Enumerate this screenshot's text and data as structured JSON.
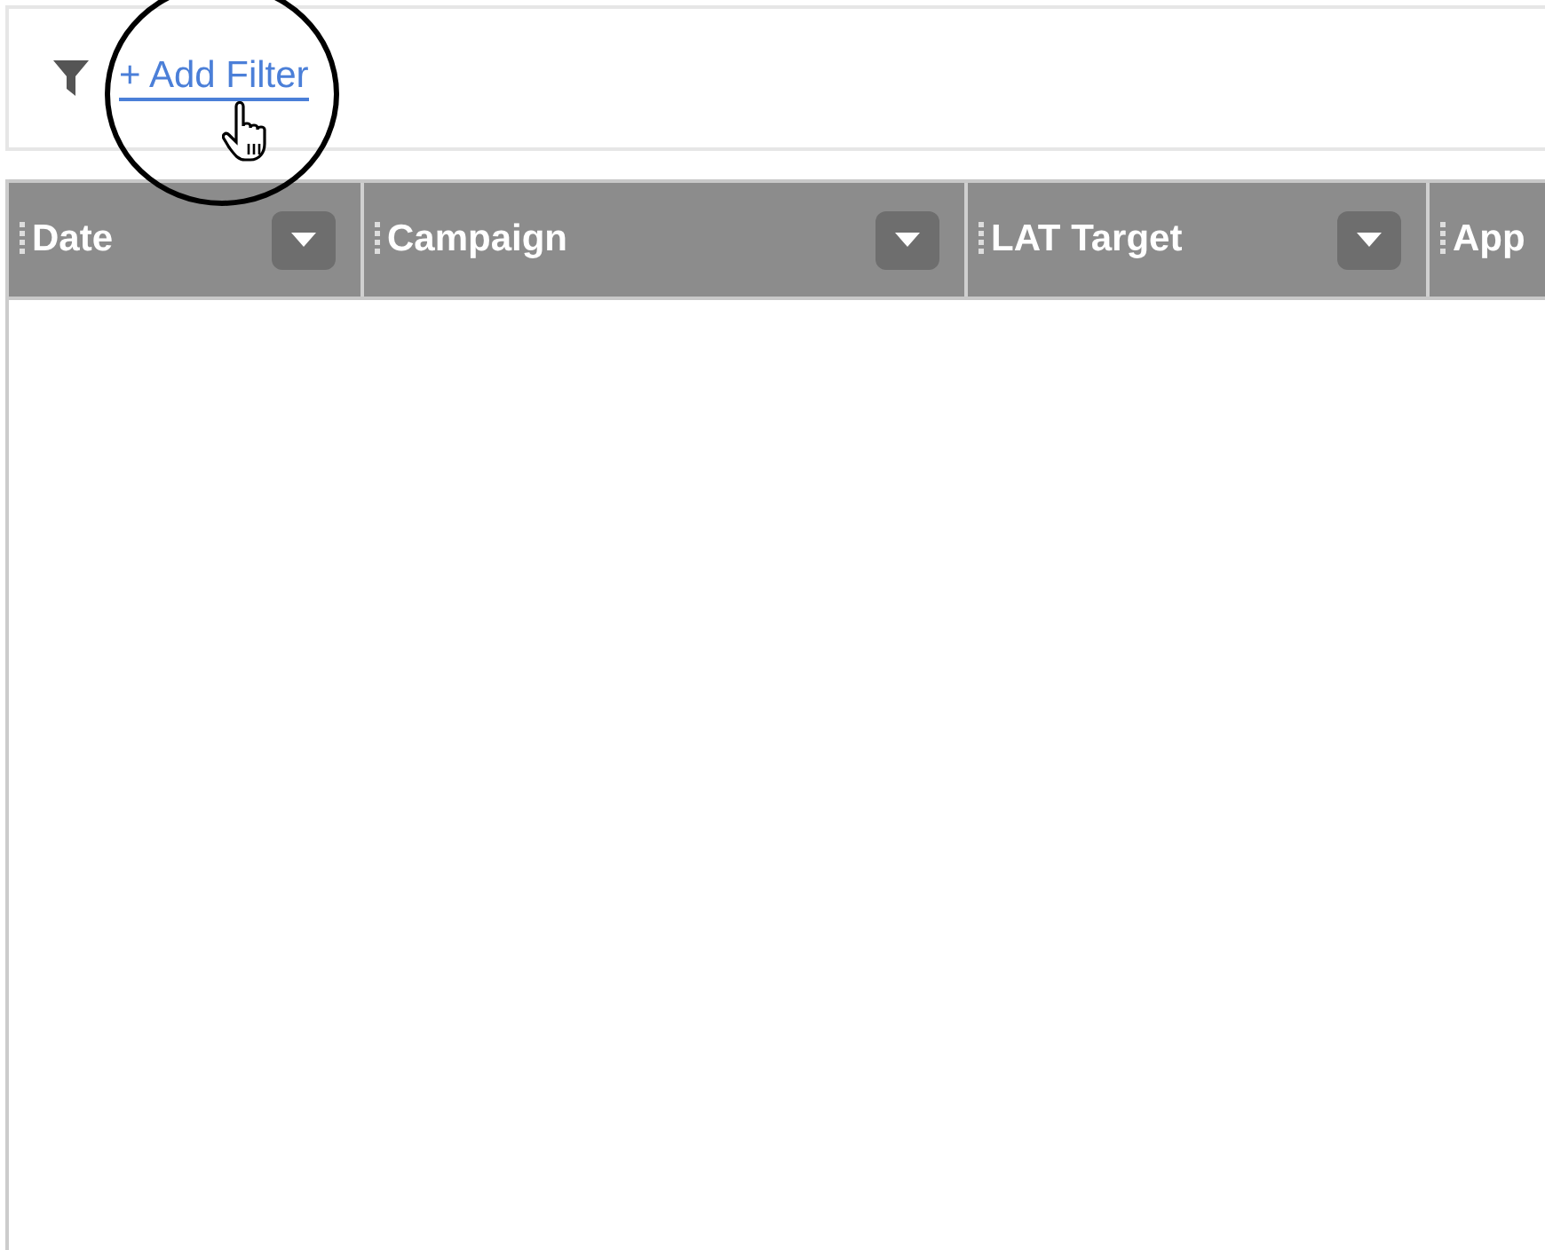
{
  "filter_bar": {
    "link": "+ Add Filter"
  },
  "table": {
    "columns": [
      {
        "label": "Date"
      },
      {
        "label": "Campaign"
      },
      {
        "label": "LAT Target"
      },
      {
        "label": "App"
      }
    ]
  }
}
